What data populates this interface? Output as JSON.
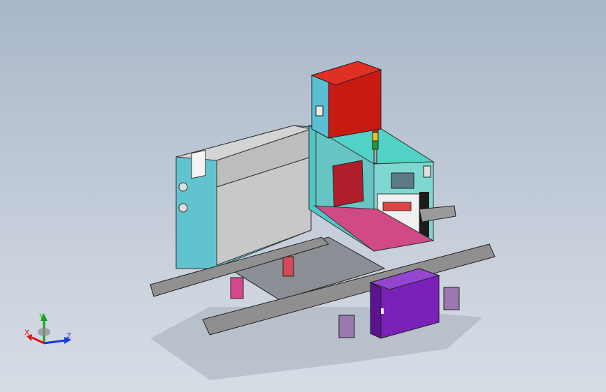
{
  "viewport": {
    "background_top": "#a9b7c9",
    "background_bottom": "#d7dde5"
  },
  "model": {
    "description_icon": "industrial-machine-assembly-3d-model",
    "colors": {
      "control_box": "#c81a12",
      "cabinet_purple": "#7a21b8",
      "frame_teal": "#4fc7c4",
      "cabinet_gray": "#c9c9c9",
      "cabinet_trim": "#62c3d0",
      "rails": "#8f8f8f",
      "mount_pink": "#d6478f"
    }
  },
  "triad": {
    "x_label": "X",
    "y_label": "Y",
    "z_label": "Z",
    "x_color": "#e01010",
    "y_color": "#18a018",
    "z_color": "#1836d8"
  }
}
